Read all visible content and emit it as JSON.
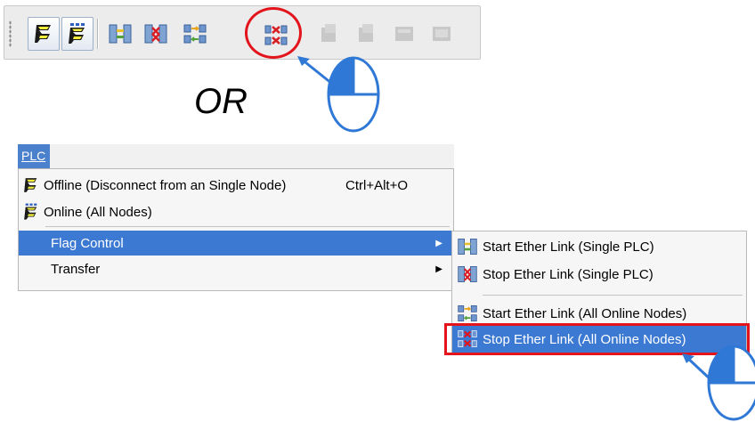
{
  "toolbar": {
    "buttons": [
      {
        "name": "offline-button",
        "icon": "plc-offline-icon"
      },
      {
        "name": "online-all-nodes-button",
        "icon": "plc-online-icon"
      },
      {
        "name": "start-ether-link-single-button",
        "icon": "start-link-single-icon"
      },
      {
        "name": "stop-ether-link-single-button",
        "icon": "stop-link-single-icon"
      },
      {
        "name": "start-ether-link-all-button",
        "icon": "start-link-all-icon"
      },
      {
        "name": "stop-ether-link-all-button",
        "icon": "stop-link-all-icon"
      }
    ],
    "highlight_color": "#e3141b"
  },
  "or_text": "OR",
  "menubar": {
    "plc_label": "PLC"
  },
  "menu": {
    "items": [
      {
        "label": "Offline (Disconnect from an Single Node)",
        "shortcut": "Ctrl+Alt+O",
        "icon": "plc-offline-icon"
      },
      {
        "label": "Online (All Nodes)",
        "icon": "plc-online-icon"
      },
      {
        "label": "Flag Control",
        "submenu": true,
        "selected": true
      },
      {
        "label": "Transfer",
        "submenu": true
      }
    ]
  },
  "submenu": {
    "items": [
      {
        "label": "Start Ether Link (Single PLC)",
        "icon": "start-link-single-icon"
      },
      {
        "label": "Stop Ether Link (Single PLC)",
        "icon": "stop-link-single-icon"
      },
      {
        "label": "Start Ether Link (All Online Nodes)",
        "icon": "start-link-all-icon"
      },
      {
        "label": "Stop Ether Link (All Online Nodes)",
        "icon": "stop-link-all-icon",
        "selected": true
      }
    ]
  },
  "colors": {
    "selection": "#3c79d3",
    "accent_red": "#e3141b",
    "mouse_blue": "#2f78d6"
  }
}
